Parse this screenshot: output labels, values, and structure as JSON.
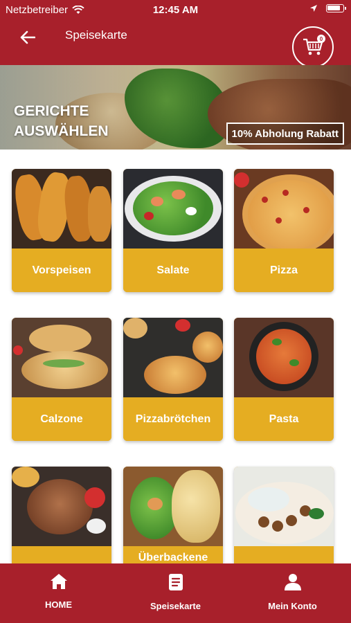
{
  "status_bar": {
    "carrier": "Netzbetreiber",
    "time": "12:45 AM"
  },
  "app_bar": {
    "title": "Speisekarte",
    "cart_count": "0"
  },
  "hero": {
    "title": "GERICHTE AUSWÄHLEN",
    "discount": "10% Abholung Rabatt"
  },
  "categories": [
    {
      "label": "Vorspeisen"
    },
    {
      "label": "Salate"
    },
    {
      "label": "Pizza"
    },
    {
      "label": "Calzone"
    },
    {
      "label": "Pizzabrötchen"
    },
    {
      "label": "Pasta"
    },
    {
      "label": ""
    },
    {
      "label": "Überbackene"
    },
    {
      "label": ""
    }
  ],
  "bottom_nav": {
    "home": "HOME",
    "menu": "Speisekarte",
    "account": "Mein Konto"
  },
  "colors": {
    "primary": "#a8202b",
    "accent": "#e5ad22"
  }
}
